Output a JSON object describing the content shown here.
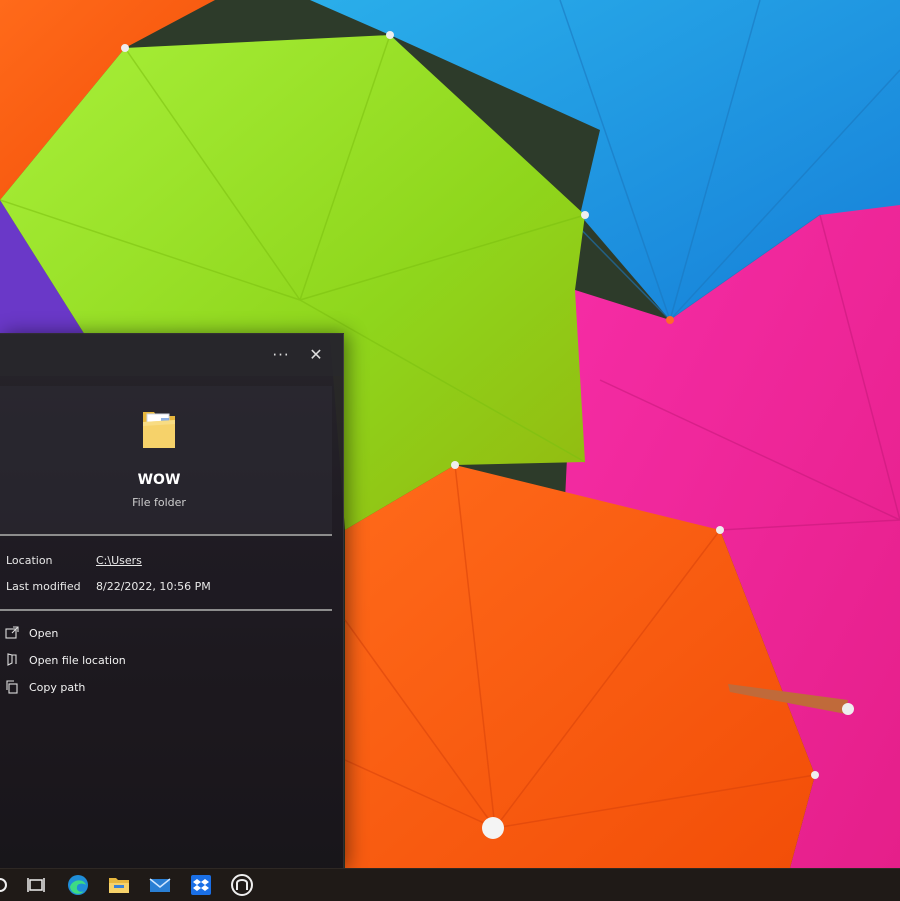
{
  "flyout": {
    "more_label": "···",
    "close_label": "✕",
    "item_name": "WOW",
    "item_type": "File folder",
    "properties": {
      "location_label": "Location",
      "location_value": "C:\\Users",
      "modified_label": "Last modified",
      "modified_value": "8/22/2022, 10:56 PM"
    },
    "actions": [
      {
        "label": "Open",
        "icon": "open-icon"
      },
      {
        "label": "Open file location",
        "icon": "file-location-icon"
      },
      {
        "label": "Copy path",
        "icon": "copy-icon"
      }
    ]
  },
  "taskbar": {
    "icons": [
      "search-icon",
      "task-view-icon",
      "edge-icon",
      "file-explorer-icon",
      "mail-icon",
      "dropbox-icon",
      "app-icon"
    ]
  },
  "colors": {
    "umbrella_orange": "#ff5a10",
    "umbrella_green": "#9be02a",
    "umbrella_blue": "#1b9fe6",
    "umbrella_pink": "#f2279e",
    "umbrella_purple": "#6a38c8"
  }
}
